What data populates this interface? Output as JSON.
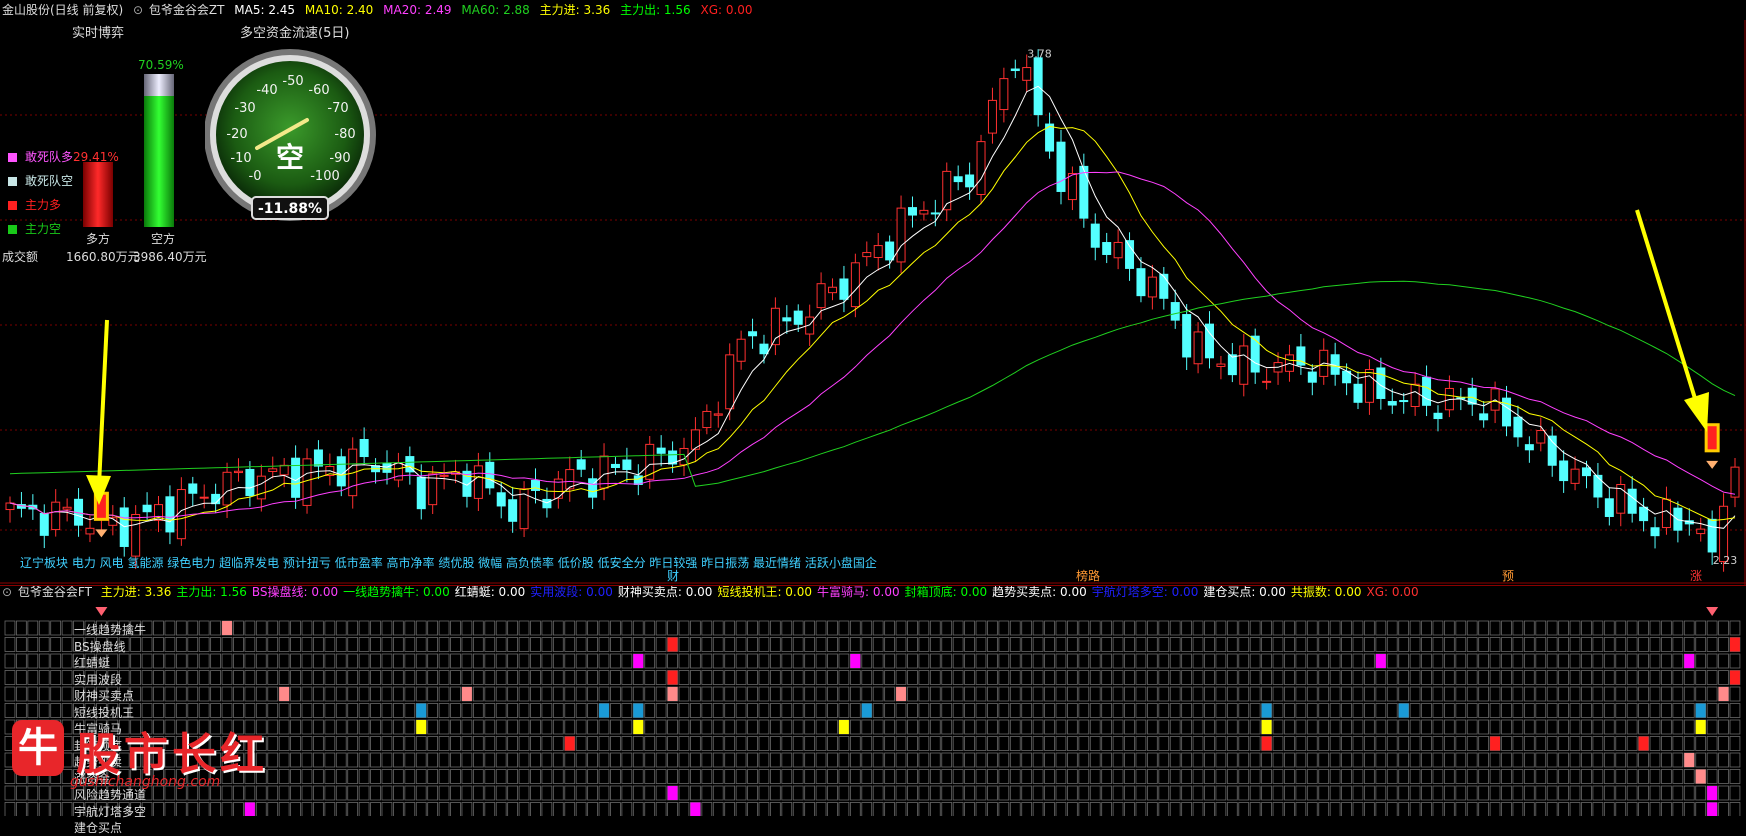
{
  "header": {
    "stock": "金山股份(日线 前复权)",
    "indicator": "包爷金谷会ZT",
    "ma5": "MA5: 2.45",
    "ma10": "MA10: 2.40",
    "ma20": "MA20: 2.49",
    "ma60": "MA60: 2.88",
    "zlj": "主力进: 3.36",
    "zlc": "主力出: 1.56",
    "xg": "XG: 0.00"
  },
  "panel": {
    "realtime_title": "实时博弈",
    "flow_title": "多空资金流速(5日)",
    "bar_pct": "70.59%",
    "legend": [
      {
        "label": "敢死队多",
        "value": "29.41%",
        "color": "#ff55ff"
      },
      {
        "label": "敢死队空",
        "value": "",
        "color": "#c8e6e6"
      },
      {
        "label": "主力多",
        "value": "",
        "color": "#ff2020"
      },
      {
        "label": "主力空",
        "value": "",
        "color": "#19c919"
      }
    ],
    "duo_label": "多方",
    "kong_label": "空方",
    "amount_label": "成交额",
    "duo_amount": "1660.80万元",
    "kong_amount": "3986.40万元",
    "gauge_ticks": [
      "-50",
      "-40",
      "-60",
      "-30",
      "-70",
      "-20",
      "-80",
      "-10",
      "-90",
      "-0",
      "-100"
    ],
    "gauge_center": "空",
    "gauge_value": "-11.88%"
  },
  "chart_data": {
    "type": "candlestick",
    "high_label": "3.78",
    "low_label": "2.23",
    "colors": {
      "up": "#ff3030",
      "down": "#54ffff",
      "ma5": "#ffffff",
      "ma10": "#ffff00",
      "ma20": "#ff40ff",
      "ma60": "#20d020"
    },
    "sectors": "辽宁板块 电力 风电 氢能源 绿色电力 超临界发电 预计扭亏 低市盈率 高市净率 绩优股 微幅 高负债率 低价股 低安全分 昨日较强 昨日振荡 最近情绪 活跃小盘国企",
    "markers": [
      {
        "text": "财",
        "color": "#3fd0ff"
      },
      {
        "text": "榜路",
        "color": "#ff9933"
      },
      {
        "text": "预",
        "color": "#ff9933"
      },
      {
        "text": "涨",
        "color": "#ff3333"
      }
    ]
  },
  "sub": {
    "title": "包爷金谷会FT",
    "fields": [
      {
        "text": "主力进: 3.36",
        "color": "#ffff00"
      },
      {
        "text": "主力出: 1.56",
        "color": "#00ff00"
      },
      {
        "text": "BS操盘线: 0.00",
        "color": "#ff40ff"
      },
      {
        "text": "一线趋势擒牛: 0.00",
        "color": "#00ff00"
      },
      {
        "text": "红蜻蜓: 0.00",
        "color": "#ffffff"
      },
      {
        "text": "实用波段: 0.00",
        "color": "#2020ff"
      },
      {
        "text": "财神买卖点: 0.00",
        "color": "#ffffff"
      },
      {
        "text": "短线投机王: 0.00",
        "color": "#ffff00"
      },
      {
        "text": "牛富骑马: 0.00",
        "color": "#ff40ff"
      },
      {
        "text": "封箱顶底: 0.00",
        "color": "#00ff00"
      },
      {
        "text": "趋势买卖点: 0.00",
        "color": "#ffffff"
      },
      {
        "text": "宇航灯塔多空: 0.00",
        "color": "#2020ff"
      },
      {
        "text": "建仓买点: 0.00",
        "color": "#ffffff"
      },
      {
        "text": "共振数: 0.00",
        "color": "#ffff00"
      },
      {
        "text": "XG: 0.00",
        "color": "#ff3030"
      }
    ],
    "rows": [
      "一线趋势擒牛",
      "BS操盘线",
      "红蜻蜓",
      "实用波段",
      "财神买卖点",
      "短线投机王",
      "牛富骑马",
      "封箱顶底",
      "趋势买卖",
      "涨资金",
      "风险趋势通道",
      "宇航灯塔多空",
      "建仓买点"
    ]
  },
  "logo": {
    "text": "股市长红",
    "url": "gushichanghong.com",
    "mark": "牛"
  }
}
